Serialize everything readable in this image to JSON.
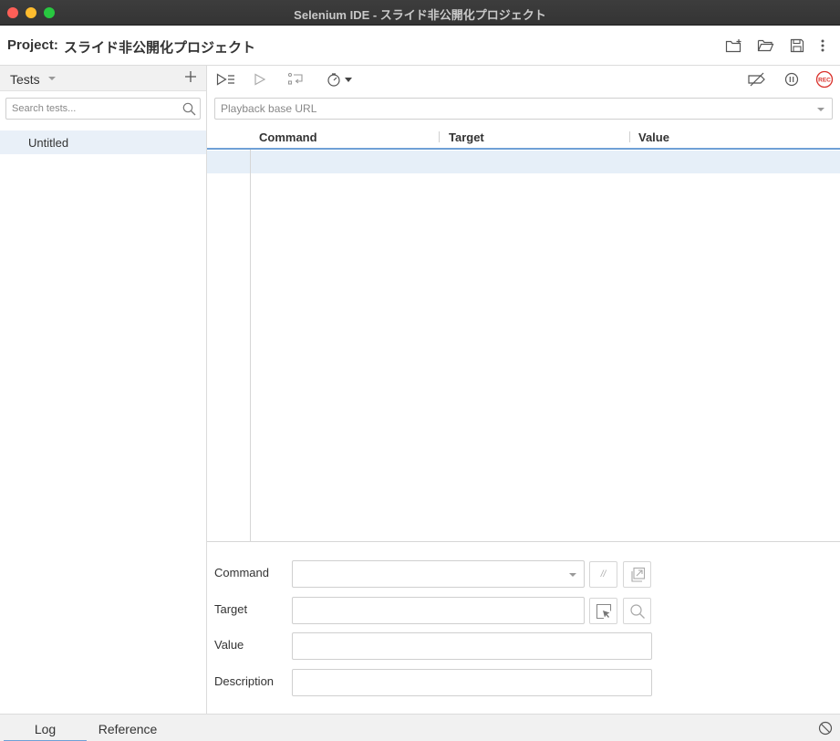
{
  "window": {
    "title": "Selenium IDE - スライド非公開化プロジェクト"
  },
  "project": {
    "label": "Project:",
    "name": "スライド非公開化プロジェクト",
    "actions": [
      "new-project-icon",
      "open-project-icon",
      "save-project-icon",
      "more-vert-icon"
    ]
  },
  "sidebar": {
    "header_label": "Tests",
    "search_placeholder": "Search tests...",
    "tests": [
      {
        "name": "Untitled",
        "selected": true
      }
    ]
  },
  "toolbar": {
    "left_icons": [
      "run-all-tests-icon",
      "run-current-test-icon",
      "step-over-icon",
      "speed-timer-icon"
    ],
    "right_icons": [
      "disable-breakpoints-icon",
      "pause-icon",
      "record-icon"
    ],
    "record_label": "REC"
  },
  "playback": {
    "url_placeholder": "Playback base URL",
    "url_value": ""
  },
  "commands_table": {
    "columns": [
      "Command",
      "Target",
      "Value"
    ],
    "rows": [
      {
        "command": "",
        "target": "",
        "value": "",
        "selected": true
      }
    ]
  },
  "editor": {
    "command_label": "Command",
    "target_label": "Target",
    "value_label": "Value",
    "description_label": "Description",
    "command_value": "",
    "target_value": "",
    "value_value": "",
    "description_value": "",
    "comment_button_text": "//"
  },
  "bottom": {
    "tabs": [
      {
        "label": "Log",
        "active": true
      },
      {
        "label": "Reference",
        "active": false
      }
    ]
  },
  "colors": {
    "accent": "#6fa0d6",
    "record": "#d9312b",
    "selection": "#e6eff8"
  }
}
